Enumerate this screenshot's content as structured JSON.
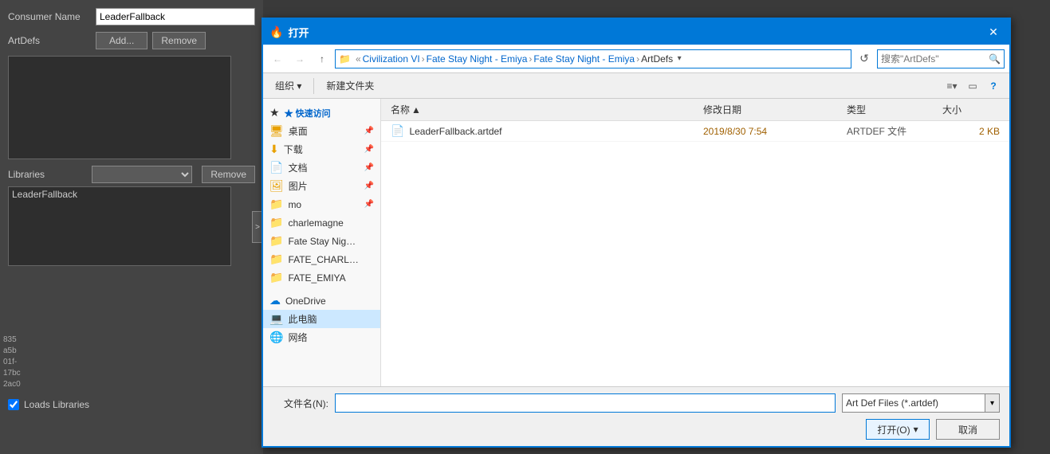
{
  "editor": {
    "consumer_name_label": "Consumer Name",
    "consumer_name_value": "LeaderFallback",
    "artdefs_label": "ArtDefs",
    "add_btn": "Add...",
    "remove_btn": "Remove",
    "libraries_label": "Libraries",
    "libraries_list_item": "LeaderFallback",
    "loads_libraries_label": "Loads Libraries",
    "hash_lines": [
      "835",
      "a5b",
      "01f-",
      "17bc",
      "2ac0"
    ],
    "arrow_btn": ">"
  },
  "dialog": {
    "title_icon": "🔥",
    "title": "打开",
    "close_btn": "✕",
    "nav": {
      "back_btn": "←",
      "forward_btn": "→",
      "up_btn": "↑",
      "breadcrumb": [
        {
          "label": "Civilization VI",
          "current": false
        },
        {
          "label": "Fate Stay Night - Emiya",
          "current": false
        },
        {
          "label": "Fate Stay Night - Emiya",
          "current": false
        },
        {
          "label": "ArtDefs",
          "current": true
        }
      ],
      "search_placeholder": "搜索\"ArtDefs\"",
      "search_value": ""
    },
    "toolbar": {
      "organize_btn": "组织 ▾",
      "new_folder_btn": "新建文件夹",
      "view_icon": "≡",
      "panel_icon": "▭",
      "help_icon": "?"
    },
    "left_nav": {
      "quick_access_label": "★ 快速访问",
      "items": [
        {
          "label": "桌面",
          "icon": "🖥",
          "pinned": true
        },
        {
          "label": "下载",
          "icon": "⬇",
          "pinned": true
        },
        {
          "label": "文档",
          "icon": "📄",
          "pinned": true
        },
        {
          "label": "图片",
          "icon": "🖼",
          "pinned": true
        },
        {
          "label": "mo",
          "icon": "📁",
          "pinned": true
        },
        {
          "label": "charlemagne",
          "icon": "📁",
          "pinned": false
        },
        {
          "label": "Fate Stay Night - E",
          "icon": "📁",
          "pinned": false
        },
        {
          "label": "FATE_CHARLEMAG(",
          "icon": "📁",
          "pinned": false
        },
        {
          "label": "FATE_EMIYA",
          "icon": "📁",
          "pinned": false
        }
      ],
      "onedrive": {
        "label": "OneDrive",
        "icon": "☁"
      },
      "thispc": {
        "label": "此电脑",
        "icon": "💻",
        "selected": true
      },
      "network": {
        "label": "网络",
        "icon": "🌐"
      }
    },
    "file_list": {
      "columns": [
        {
          "label": "名称",
          "sort": "▲"
        },
        {
          "label": "修改日期"
        },
        {
          "label": "类型"
        },
        {
          "label": "大小"
        }
      ],
      "files": [
        {
          "name": "LeaderFallback.artdef",
          "date": "2019/8/30 7:54",
          "type": "ARTDEF 文件",
          "size": "2 KB",
          "icon": "📄"
        }
      ]
    },
    "bottom": {
      "filename_label": "文件名(N):",
      "filename_value": "",
      "filetype_value": "Art Def Files (*.artdef)",
      "open_btn": "打开(O)",
      "cancel_btn": "取消"
    }
  }
}
